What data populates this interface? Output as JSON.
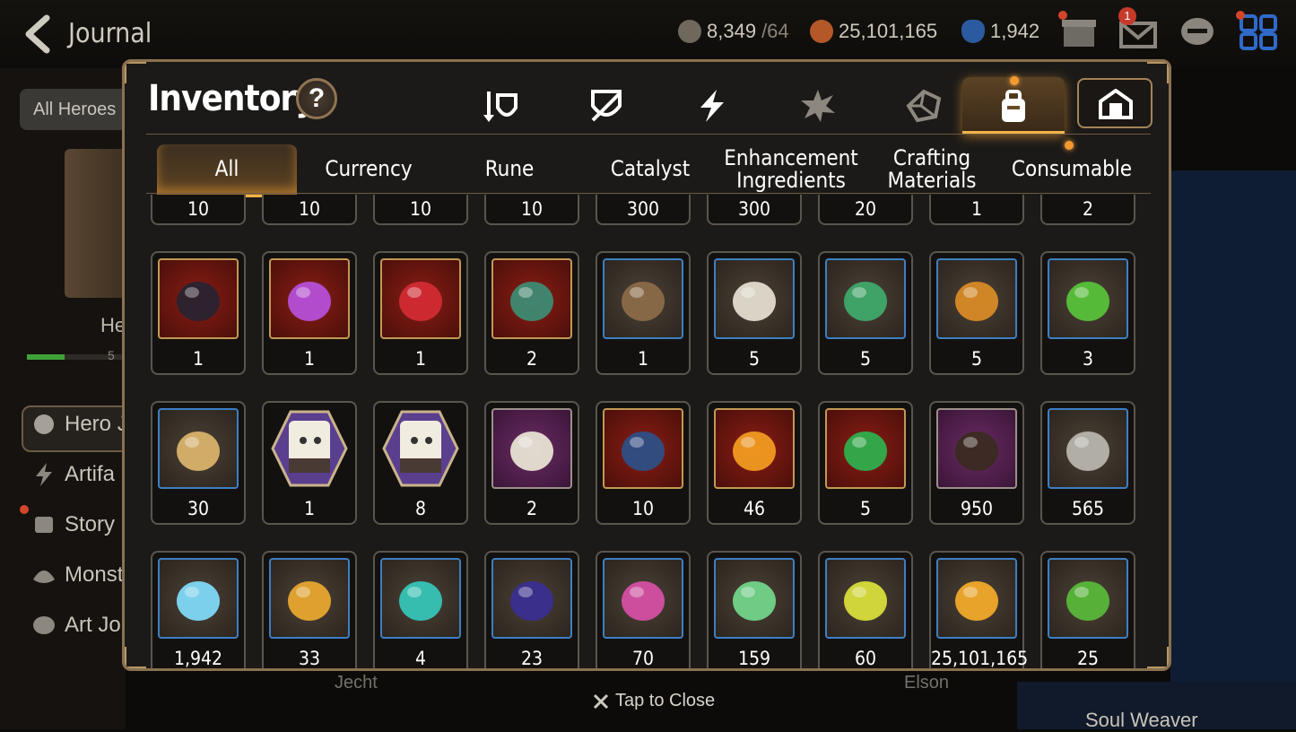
{
  "header": {
    "title": "Journal",
    "resources": [
      {
        "icon": "stamina-icon",
        "value": "8,349",
        "suffix": "/64",
        "color": "#b9b2a5"
      },
      {
        "icon": "gold-coin-icon",
        "value": "25,101,165",
        "suffix": "",
        "color": "#c9672e"
      },
      {
        "icon": "skystone-icon",
        "value": "1,942",
        "suffix": "",
        "color": "#3b76c9"
      }
    ],
    "notification_badge": "1"
  },
  "background": {
    "filter_chip": "All Heroes",
    "hero_label": "Hero",
    "hero_progress": 0.38,
    "hero_progress_text": "5",
    "menu": [
      "Hero J",
      "Artifa",
      "Story",
      "Monst",
      "Art Jo"
    ],
    "names": [
      "Jecht",
      "Elson"
    ],
    "soul_weaver": "Soul Weaver",
    "tap_to_close": "Tap to Close"
  },
  "inventory": {
    "title": "Inventory",
    "help": "?",
    "category_tabs": [
      {
        "icon": "equipment-icon"
      },
      {
        "icon": "shield-slash-icon"
      },
      {
        "icon": "lightning-icon"
      },
      {
        "icon": "burst-icon"
      },
      {
        "icon": "cube-icon"
      },
      {
        "icon": "bag-icon",
        "active": true
      },
      {
        "icon": "storage-house-icon"
      }
    ],
    "subtabs": [
      "All",
      "Currency",
      "Rune",
      "Catalyst",
      "Enhancement\nIngredients",
      "Crafting\nMaterials",
      "Consumable"
    ],
    "top_partial_counts": [
      "10",
      "10",
      "10",
      "10",
      "300",
      "300",
      "20",
      "1",
      "2"
    ],
    "rows": [
      [
        {
          "name": "dark-ore-icon",
          "frame": "red",
          "count": "1"
        },
        {
          "name": "purple-flame-icon",
          "frame": "red",
          "count": "1"
        },
        {
          "name": "red-crystals-icon",
          "frame": "red",
          "count": "1"
        },
        {
          "name": "green-rune-stone-icon",
          "frame": "red",
          "count": "2"
        },
        {
          "name": "leather-scroll-icon",
          "frame": "blue",
          "count": "1"
        },
        {
          "name": "skull-crossbones-icon",
          "frame": "blue",
          "count": "5"
        },
        {
          "name": "green-compass-icon",
          "frame": "blue",
          "count": "5"
        },
        {
          "name": "golden-amulet-icon",
          "frame": "blue",
          "count": "5"
        },
        {
          "name": "colored-orbs-icon",
          "frame": "blue",
          "count": "3"
        }
      ],
      [
        {
          "name": "herb-root-icon",
          "frame": "blue",
          "count": "30"
        },
        {
          "name": "pet-pouch-icon",
          "frame": "pet",
          "count": "1"
        },
        {
          "name": "pet-snack-icon",
          "frame": "pet",
          "count": "8"
        },
        {
          "name": "feather-wand-icon",
          "frame": "purple",
          "count": "2"
        },
        {
          "name": "blue-ring-pendant-icon",
          "frame": "red",
          "count": "10"
        },
        {
          "name": "orange-crystal-icon",
          "frame": "red",
          "count": "46"
        },
        {
          "name": "clover-pendant-icon",
          "frame": "red",
          "count": "5"
        },
        {
          "name": "dark-horn-icon",
          "frame": "purple",
          "count": "950"
        },
        {
          "name": "silver-coin-icon",
          "frame": "blue",
          "count": "565"
        }
      ],
      [
        {
          "name": "sky-stone-icon",
          "frame": "blue",
          "count": "1,942"
        },
        {
          "name": "star-pendant-icon",
          "frame": "blue",
          "count": "33"
        },
        {
          "name": "teal-crystal-icon",
          "frame": "blue",
          "count": "4"
        },
        {
          "name": "purple-card-icon",
          "frame": "blue",
          "count": "23"
        },
        {
          "name": "pink-mountain-icon",
          "frame": "blue",
          "count": "70"
        },
        {
          "name": "green-leaf-icon",
          "frame": "blue",
          "count": "159"
        },
        {
          "name": "yellow-card-icon",
          "frame": "blue",
          "count": "60"
        },
        {
          "name": "gold-coin-icon",
          "frame": "blue",
          "count": "25,101,165"
        },
        {
          "name": "green-heart-icon",
          "frame": "blue",
          "count": "25"
        }
      ]
    ],
    "item_colors": {
      "dark-ore-icon": "#2a2330",
      "purple-flame-icon": "#b44fd8",
      "red-crystals-icon": "#d22a34",
      "green-rune-stone-icon": "#3e8a74",
      "leather-scroll-icon": "#8b6a48",
      "skull-crossbones-icon": "#e2dccd",
      "green-compass-icon": "#3fa86a",
      "golden-amulet-icon": "#d88a26",
      "colored-orbs-icon": "#57c13a",
      "herb-root-icon": "#d9b26a",
      "pet-pouch-icon": "#5b3f8f",
      "pet-snack-icon": "#5b3f8f",
      "feather-wand-icon": "#e8e1d4",
      "blue-ring-pendant-icon": "#2e4f86",
      "orange-crystal-icon": "#f19a21",
      "clover-pendant-icon": "#2fae4d",
      "dark-horn-icon": "#3b2a22",
      "silver-coin-icon": "#b7b4ad",
      "sky-stone-icon": "#7fd8f7",
      "star-pendant-icon": "#e7a62f",
      "teal-crystal-icon": "#36c4b7",
      "purple-card-icon": "#3a2e8f",
      "pink-mountain-icon": "#d44fa3",
      "green-leaf-icon": "#72d48a",
      "yellow-card-icon": "#d8dd3a",
      "gold-coin-icon": "#f0a92a",
      "green-heart-icon": "#58b73a"
    }
  }
}
